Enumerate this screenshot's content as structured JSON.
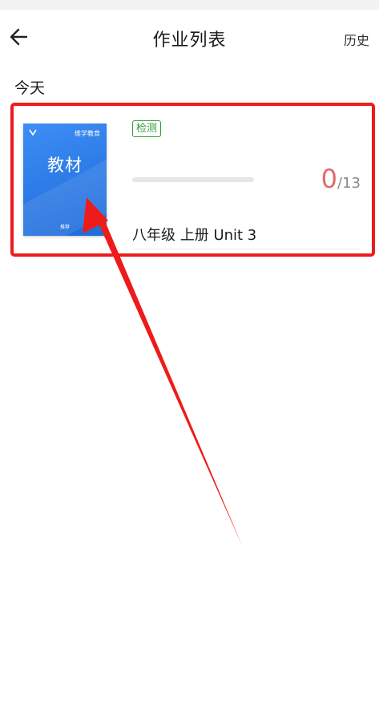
{
  "header": {
    "title": "作业列表",
    "history_label": "历史"
  },
  "section": {
    "label": "今天"
  },
  "assignment": {
    "badge": "检测",
    "cover": {
      "brand": "维学教育",
      "title": "教材",
      "footer": "推荐",
      "color": "#2f7de8"
    },
    "progress": {
      "done": "0",
      "separator": "/",
      "total": "13",
      "fraction": 0
    },
    "title": "八年级 上册 Unit 3"
  },
  "annotation": {
    "color": "#ee1b1b"
  },
  "icons": {
    "back": "back-arrow-icon",
    "cover_logo": "chevron-logo-icon"
  }
}
